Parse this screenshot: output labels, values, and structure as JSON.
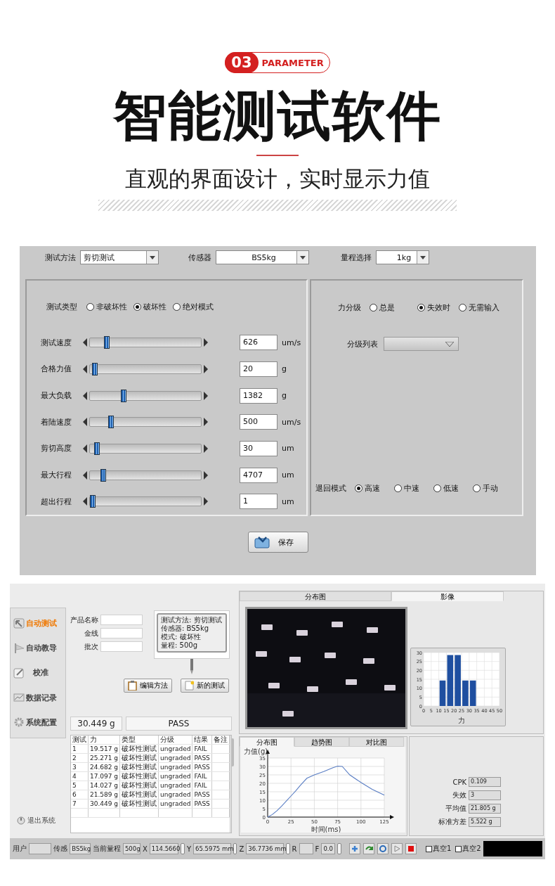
{
  "header": {
    "badge": "03",
    "tag": "PARAMETER",
    "title": "智能测试软件",
    "subtitle": "直观的界面设计，实时显示力值"
  },
  "settings_screen": {
    "top_fields": [
      {
        "label": "测试方法",
        "value": "剪切测试"
      },
      {
        "label": "传感器",
        "value": "BS5kg"
      },
      {
        "label": "量程选择",
        "value": "1kg"
      }
    ],
    "test_type": {
      "label": "测试类型",
      "options": [
        {
          "label": "非破坏性",
          "selected": false
        },
        {
          "label": "破坏性",
          "selected": true
        },
        {
          "label": "绝对模式",
          "selected": false
        }
      ]
    },
    "sliders": [
      {
        "label": "测试速度",
        "level": 0.13,
        "value": "626",
        "unit": "um/s"
      },
      {
        "label": "合格力值",
        "level": 0.02,
        "value": "20",
        "unit": "g"
      },
      {
        "label": "最大负载",
        "level": 0.29,
        "value": "1382",
        "unit": "g"
      },
      {
        "label": "着陆速度",
        "level": 0.17,
        "value": "500",
        "unit": "um/s"
      },
      {
        "label": "剪切高度",
        "level": 0.04,
        "value": "30",
        "unit": "um"
      },
      {
        "label": "最大行程",
        "level": 0.1,
        "value": "4707",
        "unit": "um"
      },
      {
        "label": "超出行程",
        "level": 0.0,
        "value": "1",
        "unit": "um"
      }
    ],
    "force_grading": {
      "label": "力分级",
      "options": [
        {
          "label": "总是",
          "selected": false
        },
        {
          "label": "失效时",
          "selected": true
        },
        {
          "label": "无需输入",
          "selected": false
        }
      ]
    },
    "grading_list": {
      "label": "分级列表"
    },
    "return_mode": {
      "label": "退回模式",
      "options": [
        {
          "label": "高速",
          "selected": true
        },
        {
          "label": "中速",
          "selected": false
        },
        {
          "label": "低速",
          "selected": false
        },
        {
          "label": "手动",
          "selected": false
        }
      ]
    },
    "save_button": "保存"
  },
  "test_screen": {
    "sidebar": {
      "items": [
        {
          "label": "自动测试",
          "selected": true
        },
        {
          "label": "自动教导",
          "selected": false
        },
        {
          "label": "校准",
          "selected": false
        },
        {
          "label": "数据记录",
          "selected": false
        },
        {
          "label": "系统配置",
          "selected": false
        }
      ],
      "exit": "退出系统"
    },
    "fields": [
      {
        "label": "产品名称"
      },
      {
        "label": "金线"
      },
      {
        "label": "批次"
      }
    ],
    "method_info": [
      "测试方法: 剪切测试",
      "传感器: BS5kg",
      "模式: 破坏性",
      "量程: 500g"
    ],
    "buttons": [
      "编辑方法",
      "新的测试"
    ],
    "reading": "30.449 g",
    "result": "PASS",
    "table": {
      "columns": [
        "测试",
        "力",
        "类型",
        "分级",
        "结果",
        "备注"
      ],
      "rows": [
        [
          "1",
          "19.517 g",
          "破坏性测试",
          "ungraded",
          "FAIL",
          ""
        ],
        [
          "2",
          "25.271 g",
          "破坏性测试",
          "ungraded",
          "PASS",
          ""
        ],
        [
          "3",
          "24.682 g",
          "破坏性测试",
          "ungraded",
          "PASS",
          ""
        ],
        [
          "4",
          "17.097 g",
          "破坏性测试",
          "ungraded",
          "FAIL",
          ""
        ],
        [
          "5",
          "14.027 g",
          "破坏性测试",
          "ungraded",
          "FAIL",
          ""
        ],
        [
          "6",
          "21.589 g",
          "破坏性测试",
          "ungraded",
          "PASS",
          ""
        ],
        [
          "7",
          "30.449 g",
          "破坏性测试",
          "ungraded",
          "PASS",
          ""
        ]
      ]
    },
    "top_tabs": [
      {
        "label": "分布图",
        "selected": false
      },
      {
        "label": "影像",
        "selected": true
      }
    ],
    "histogram": {
      "chart_data": {
        "type": "bar",
        "grid": true,
        "xlabel": "力",
        "x": [
          12.5,
          17.5,
          22.5,
          27.5,
          32.5
        ],
        "values": [
          14.3,
          28.6,
          28.6,
          14.3,
          14.3
        ],
        "xlim": [
          0,
          50
        ],
        "ylim": [
          0,
          30
        ],
        "xticks": [
          0,
          5,
          10,
          15,
          20,
          25,
          30,
          35,
          40,
          45,
          50
        ],
        "yticks": [
          0,
          5,
          10,
          15,
          20,
          25,
          30
        ]
      }
    },
    "bottom_tabs": [
      {
        "label": "分布图",
        "selected": true
      },
      {
        "label": "趋势图",
        "selected": false
      },
      {
        "label": "对比图",
        "selected": false
      }
    ],
    "line_chart": {
      "chart_data": {
        "type": "line",
        "grid": true,
        "xlabel": "时间(ms)",
        "ylabel": "力值(g)",
        "x": [
          0,
          5,
          10,
          15,
          20,
          25,
          30,
          35,
          42,
          50,
          60,
          70,
          75,
          80,
          88,
          100,
          112,
          125
        ],
        "series": [
          {
            "color": "#5a7ec4",
            "values": [
              0,
              1.5,
              3.8,
              6.5,
              9.5,
              12.5,
              15.5,
              18.8,
              23,
              25,
              27,
              29.3,
              30.2,
              30,
              25,
              20.5,
              16.5,
              13
            ]
          }
        ],
        "xlim": [
          0,
          125
        ],
        "ylim": [
          0,
          35
        ],
        "xticks": [
          0,
          25,
          50,
          75,
          100,
          125
        ],
        "yticks": [
          0,
          5,
          10,
          15,
          20,
          25,
          30,
          35
        ]
      }
    },
    "stats": [
      {
        "label": "CPK",
        "value": "0.109"
      },
      {
        "label": "失效",
        "value": "3"
      },
      {
        "label": "平均值",
        "value": "21.805 g"
      },
      {
        "label": "标准方差",
        "value": "5.522 g"
      }
    ],
    "status_bar": {
      "fields": [
        {
          "label": "用户",
          "handle": false
        },
        {
          "label": "传感",
          "value": "BS5kg",
          "handle": false
        },
        {
          "label": "当前量程",
          "value": "500g",
          "handle": false
        },
        {
          "label": "X",
          "value": "114.5660",
          "handle": true
        },
        {
          "label": "Y",
          "value": "65.5975 mm",
          "handle": true
        },
        {
          "label": "Z",
          "value": "36.7736 mm",
          "handle": true
        },
        {
          "label": "R",
          "handle": false
        },
        {
          "label": "F",
          "value": "0.0",
          "handle": true
        }
      ],
      "checkboxes": [
        {
          "label": "真空1",
          "checked": false
        },
        {
          "label": "真空2",
          "checked": false
        }
      ]
    }
  }
}
